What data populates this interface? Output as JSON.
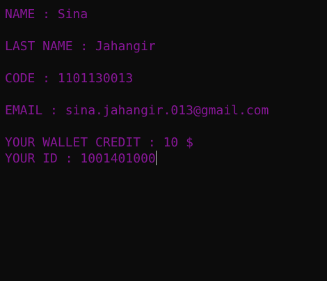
{
  "terminal": {
    "text_color": "#881798",
    "background_color": "#0c0c0c",
    "lines": [
      "NAME : Sina",
      "LAST NAME : Jahangir",
      "CODE : 1101130013",
      "EMAIL : sina.jahangir.013@gmail.com",
      "YOUR WALLET CREDIT : 10 $",
      "YOUR ID : 1001401000"
    ]
  }
}
